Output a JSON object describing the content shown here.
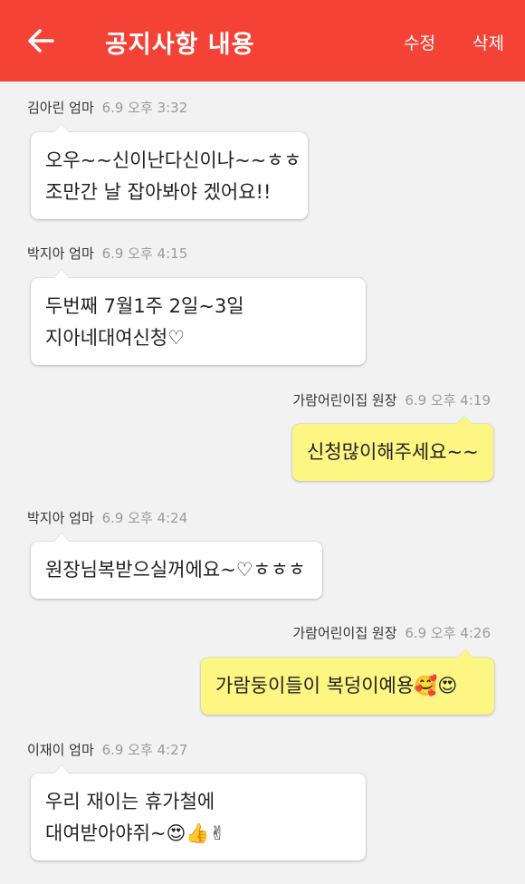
{
  "header": {
    "back_icon": "arrow-left-icon",
    "title": "공지사항 내용",
    "edit_label": "수정",
    "delete_label": "삭제",
    "bar_color": "#f44336"
  },
  "messages": [
    {
      "author": "김아린 엄마",
      "time": "6.9 오후 3:32",
      "side": "theirs",
      "lines": [
        "오우~~신이난다신이나~~ㅎㅎ",
        "조만간 날 잡아봐야 겠어요!!"
      ]
    },
    {
      "author": "박지아 엄마",
      "time": "6.9 오후 4:15",
      "side": "theirs",
      "lines": [
        "두번째 7월1주 2일~3일",
        "지아네대여신청♡"
      ]
    },
    {
      "author": "가람어린이집 원장",
      "time": "6.9 오후 4:19",
      "side": "mine",
      "lines": [
        "신청많이해주세요~~"
      ]
    },
    {
      "author": "박지아 엄마",
      "time": "6.9 오후 4:24",
      "side": "theirs",
      "lines": [
        "원장님복받으실꺼에요~♡ㅎㅎㅎ"
      ]
    },
    {
      "author": "가람어린이집 원장",
      "time": "6.9 오후 4:26",
      "side": "mine",
      "lines": [
        "가람둥이들이 복덩이예용🥰😍"
      ]
    },
    {
      "author": "이재이 엄마",
      "time": "6.9 오후 4:27",
      "side": "theirs",
      "lines": [
        "우리 재이는 휴가철에",
        "대여받아야쥐~😍👍✌"
      ]
    }
  ],
  "colors": {
    "my_bubble": "#fef683",
    "their_bubble": "#ffffff",
    "background": "#f2f2f2"
  }
}
